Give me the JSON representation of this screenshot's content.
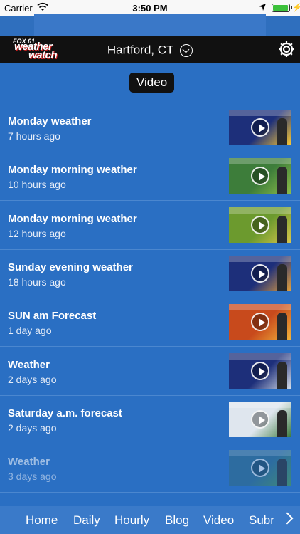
{
  "status_bar": {
    "carrier": "Carrier",
    "time": "3:50 PM",
    "battery_level": 0.95,
    "battery_color": "#3cc13b"
  },
  "header": {
    "logo_channel": "FOX 61",
    "logo_word_1": "weather",
    "logo_word_2": "watch",
    "location": "Hartford, CT",
    "location_icon": "chevron-down-circle-icon",
    "settings_icon": "gear-icon"
  },
  "section_label": "Video",
  "videos": [
    {
      "title": "Monday weather",
      "age": "7 hours ago",
      "thumb_colors": [
        "#1d2f7a",
        "#ffcc33"
      ]
    },
    {
      "title": "Monday morning weather",
      "age": "10 hours ago",
      "thumb_colors": [
        "#3d7d3a",
        "#8dbd4a"
      ]
    },
    {
      "title": "Monday morning weather",
      "age": "12 hours ago",
      "thumb_colors": [
        "#6c9a2e",
        "#d9c64c"
      ]
    },
    {
      "title": "Sunday evening weather",
      "age": "18 hours ago",
      "thumb_colors": [
        "#1d2f7a",
        "#e8a23a"
      ]
    },
    {
      "title": "SUN am Forecast",
      "age": "1 day ago",
      "thumb_colors": [
        "#c84a1c",
        "#f2b43a"
      ]
    },
    {
      "title": "Weather",
      "age": "2 days ago",
      "thumb_colors": [
        "#1d2f7a",
        "#d8e0ea"
      ]
    },
    {
      "title": "Saturday a.m. forecast",
      "age": "2 days ago",
      "thumb_colors": [
        "#dfe6ee",
        "#3a7a3c"
      ]
    },
    {
      "title": "Weather",
      "age": "3 days ago",
      "thumb_colors": [
        "#2f6b8a",
        "#4d9b4a"
      ]
    }
  ],
  "tabs": [
    {
      "label": "Home",
      "active": false
    },
    {
      "label": "Daily",
      "active": false
    },
    {
      "label": "Hourly",
      "active": false
    },
    {
      "label": "Blog",
      "active": false
    },
    {
      "label": "Video",
      "active": true
    },
    {
      "label": "Subr",
      "active": false
    }
  ],
  "colors": {
    "background": "#2a6fc3",
    "header": "#111111",
    "tabbar": "#3a7ac9"
  }
}
